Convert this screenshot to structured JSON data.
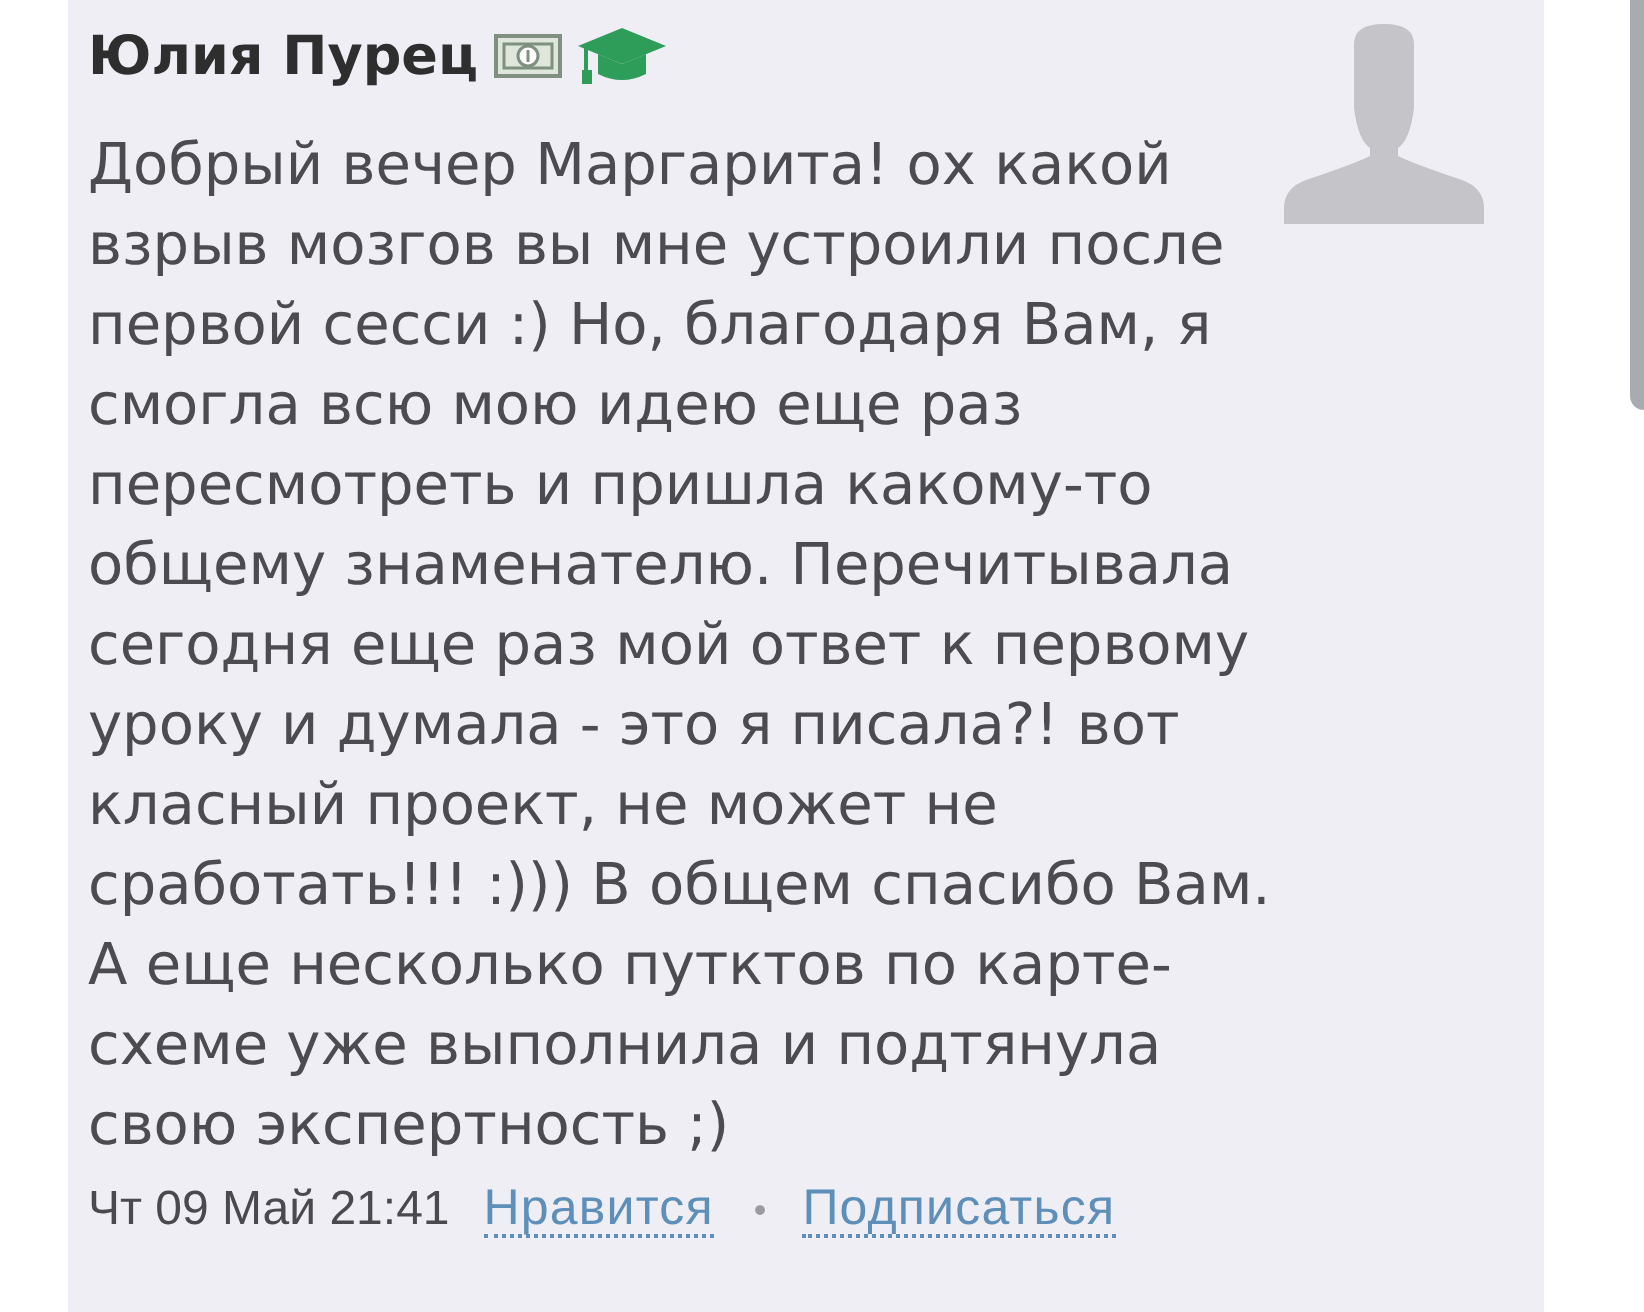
{
  "comment": {
    "author": "Юлия Пурец",
    "badges": [
      {
        "kind": "banknote"
      },
      {
        "kind": "graduate"
      }
    ],
    "text": "Добрый вечер Маргарита! ох какой взрыв мозгов вы мне устроили после первой сесси :) Но, благодаря Вам, я смогла всю мою идею еще раз пересмотреть и пришла какому-то общему знаменателю. Перечитывала сегодня еще раз мой ответ к первому уроку и думала - это я писала?! вот класный проект, не может не сработать!!! :))) В общем спасибо Вам. А еще несколько путктов по карте-схеме уже выполнила и подтянула свою экспертность ;)",
    "date": "Чт 09 Май 21:41",
    "actions": [
      {
        "label": "Нравится"
      },
      {
        "label": "Подписаться"
      }
    ],
    "separator": "•"
  }
}
